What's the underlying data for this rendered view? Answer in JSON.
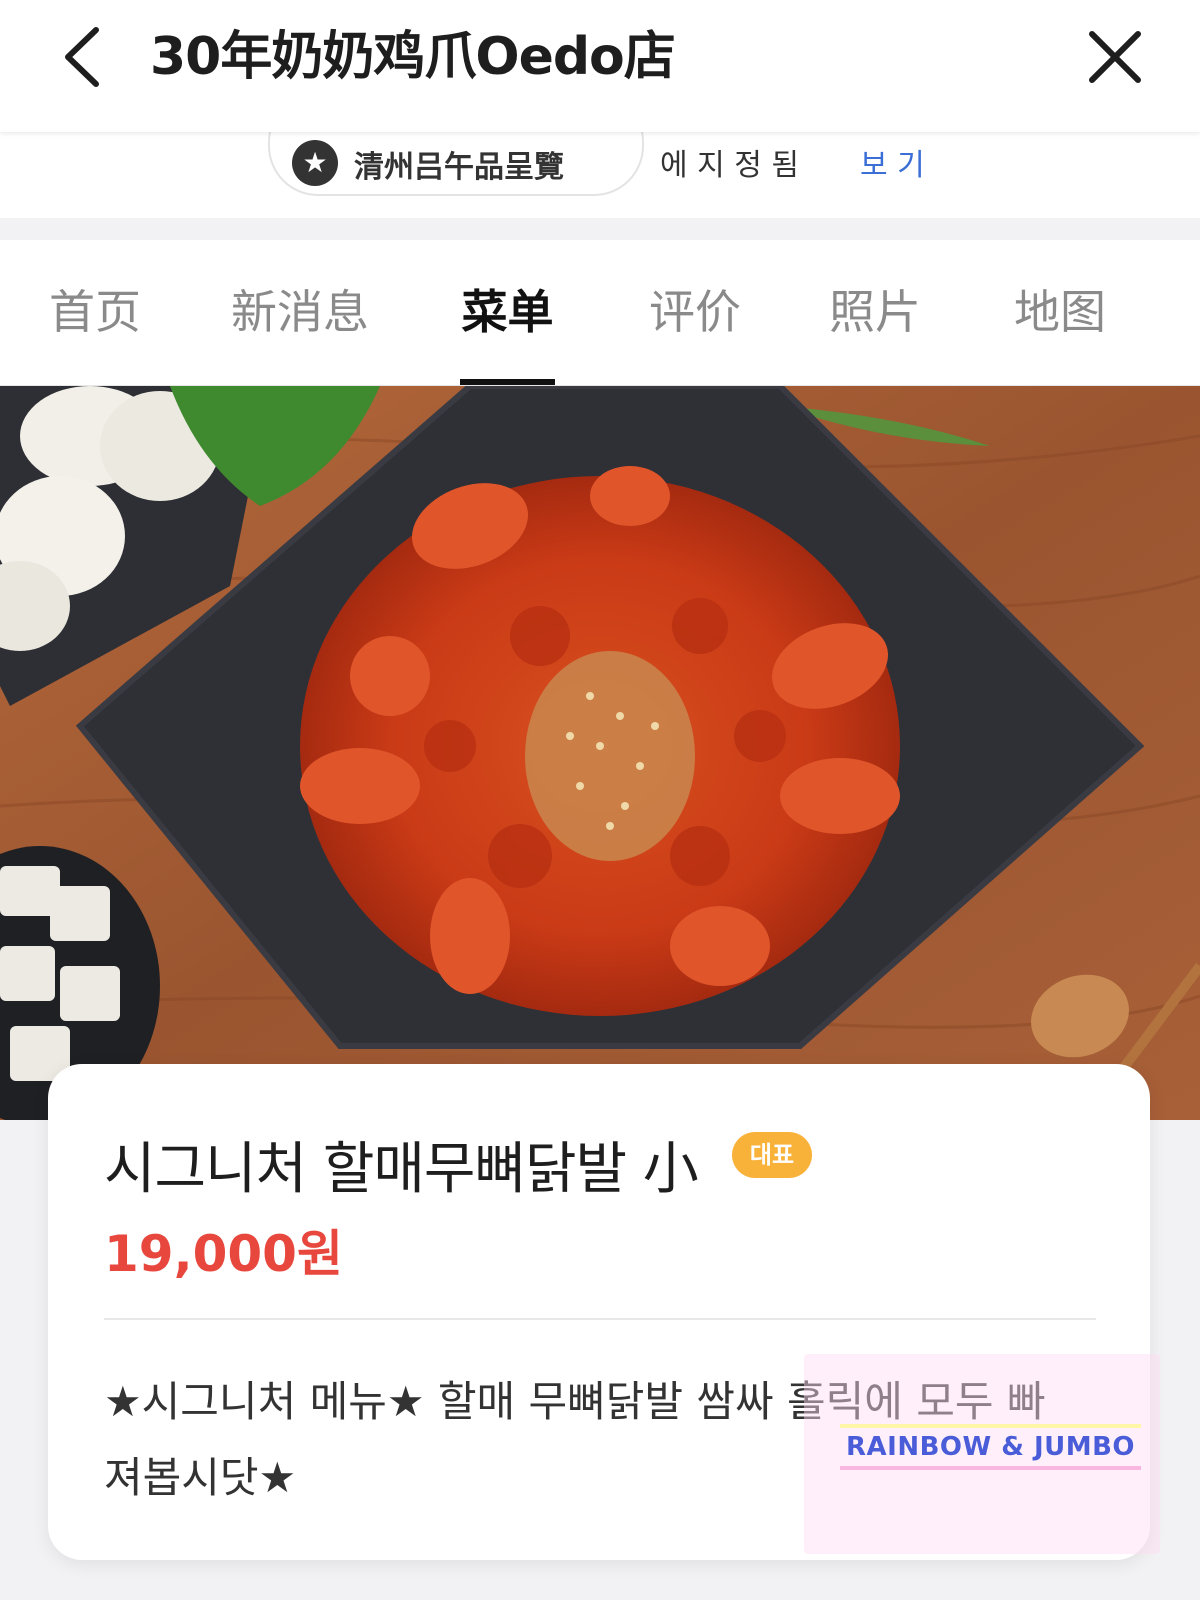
{
  "header": {
    "title": "30年奶奶鸡爪Oedo店",
    "back_icon": "chevron-left-icon",
    "close_icon": "close-icon"
  },
  "strip": {
    "award_icon": "star-icon",
    "award_text": "清州吕午品呈覽",
    "info_text": "에 지 정 됨",
    "link_text": "보 기"
  },
  "tabs": [
    {
      "label": "首页",
      "active": false
    },
    {
      "label": "新消息",
      "active": false
    },
    {
      "label": "菜单",
      "active": true
    },
    {
      "label": "评价",
      "active": false
    },
    {
      "label": "照片",
      "active": false
    },
    {
      "label": "地图",
      "active": false
    }
  ],
  "menu_item": {
    "name": "시그니처 할매무뼈닭발 小",
    "badge": "대표",
    "price": "19,000원",
    "description": "★시그니처 메뉴★ 할매 무뼈닭발 쌈싸 홀릭에 모두 빠져봅시닷★"
  },
  "watermark": {
    "text": "RAINBOW & JUMBO"
  },
  "colors": {
    "price_red": "#e8473d",
    "badge_orange": "#f8b23a",
    "link_blue": "#3b6fd6"
  }
}
